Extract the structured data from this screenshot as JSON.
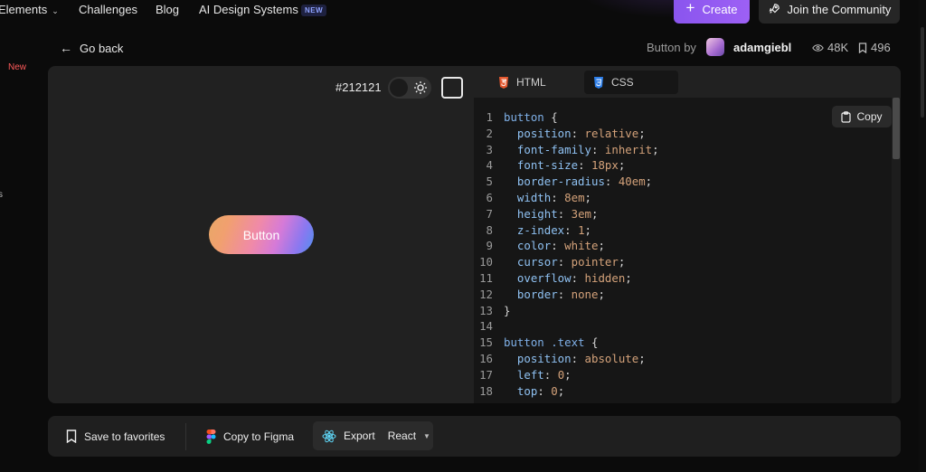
{
  "nav": {
    "elements": "Elements",
    "challenges": "Challenges",
    "blog": "Blog",
    "ai_design": "AI Design Systems",
    "ai_badge": "NEW",
    "create": "Create",
    "community": "Join the Community"
  },
  "sidebar": {
    "new_label": "New",
    "fragment": "s"
  },
  "header": {
    "go_back": "Go back",
    "by_prefix": "Button by",
    "author": "adamgiebl",
    "views": "48K",
    "saves": "496"
  },
  "preview": {
    "bg_hex": "#212121",
    "button_label": "Button"
  },
  "tabs": {
    "html": "HTML",
    "css": "CSS",
    "active": "CSS"
  },
  "editor": {
    "copy_label": "Copy",
    "lines": [
      {
        "n": "1",
        "sel": "button",
        "rest": " {"
      },
      {
        "n": "2",
        "prop": "position",
        "val": "relative"
      },
      {
        "n": "3",
        "prop": "font-family",
        "val": "inherit"
      },
      {
        "n": "4",
        "prop": "font-size",
        "val": "18px"
      },
      {
        "n": "5",
        "prop": "border-radius",
        "val": "40em"
      },
      {
        "n": "6",
        "prop": "width",
        "val": "8em"
      },
      {
        "n": "7",
        "prop": "height",
        "val": "3em"
      },
      {
        "n": "8",
        "prop": "z-index",
        "val": "1"
      },
      {
        "n": "9",
        "prop": "color",
        "val": "white"
      },
      {
        "n": "10",
        "prop": "cursor",
        "val": "pointer"
      },
      {
        "n": "11",
        "prop": "overflow",
        "val": "hidden"
      },
      {
        "n": "12",
        "prop": "border",
        "val": "none"
      },
      {
        "n": "13",
        "close": "}"
      },
      {
        "n": "14"
      },
      {
        "n": "15",
        "sel": "button .text",
        "rest": " {"
      },
      {
        "n": "16",
        "prop": "position",
        "val": "absolute"
      },
      {
        "n": "17",
        "prop": "left",
        "val": "0"
      },
      {
        "n": "18",
        "prop": "top",
        "val": "0"
      }
    ]
  },
  "toolbar": {
    "save": "Save to favorites",
    "figma": "Copy to Figma",
    "export": "Export",
    "framework": "React"
  },
  "colors": {
    "accent": "#9b5cf6",
    "badge_text": "#8ea2ff",
    "new_red": "#ff5a5a",
    "card_bg": "#212121",
    "editor_bg": "#161616"
  },
  "icons": [
    "chevron-down-icon",
    "plus-icon",
    "rocket-icon",
    "arrow-left-icon",
    "eye-icon",
    "bookmark-icon",
    "sun-icon",
    "html5-icon",
    "css3-icon",
    "clipboard-icon",
    "figma-icon",
    "react-icon"
  ]
}
